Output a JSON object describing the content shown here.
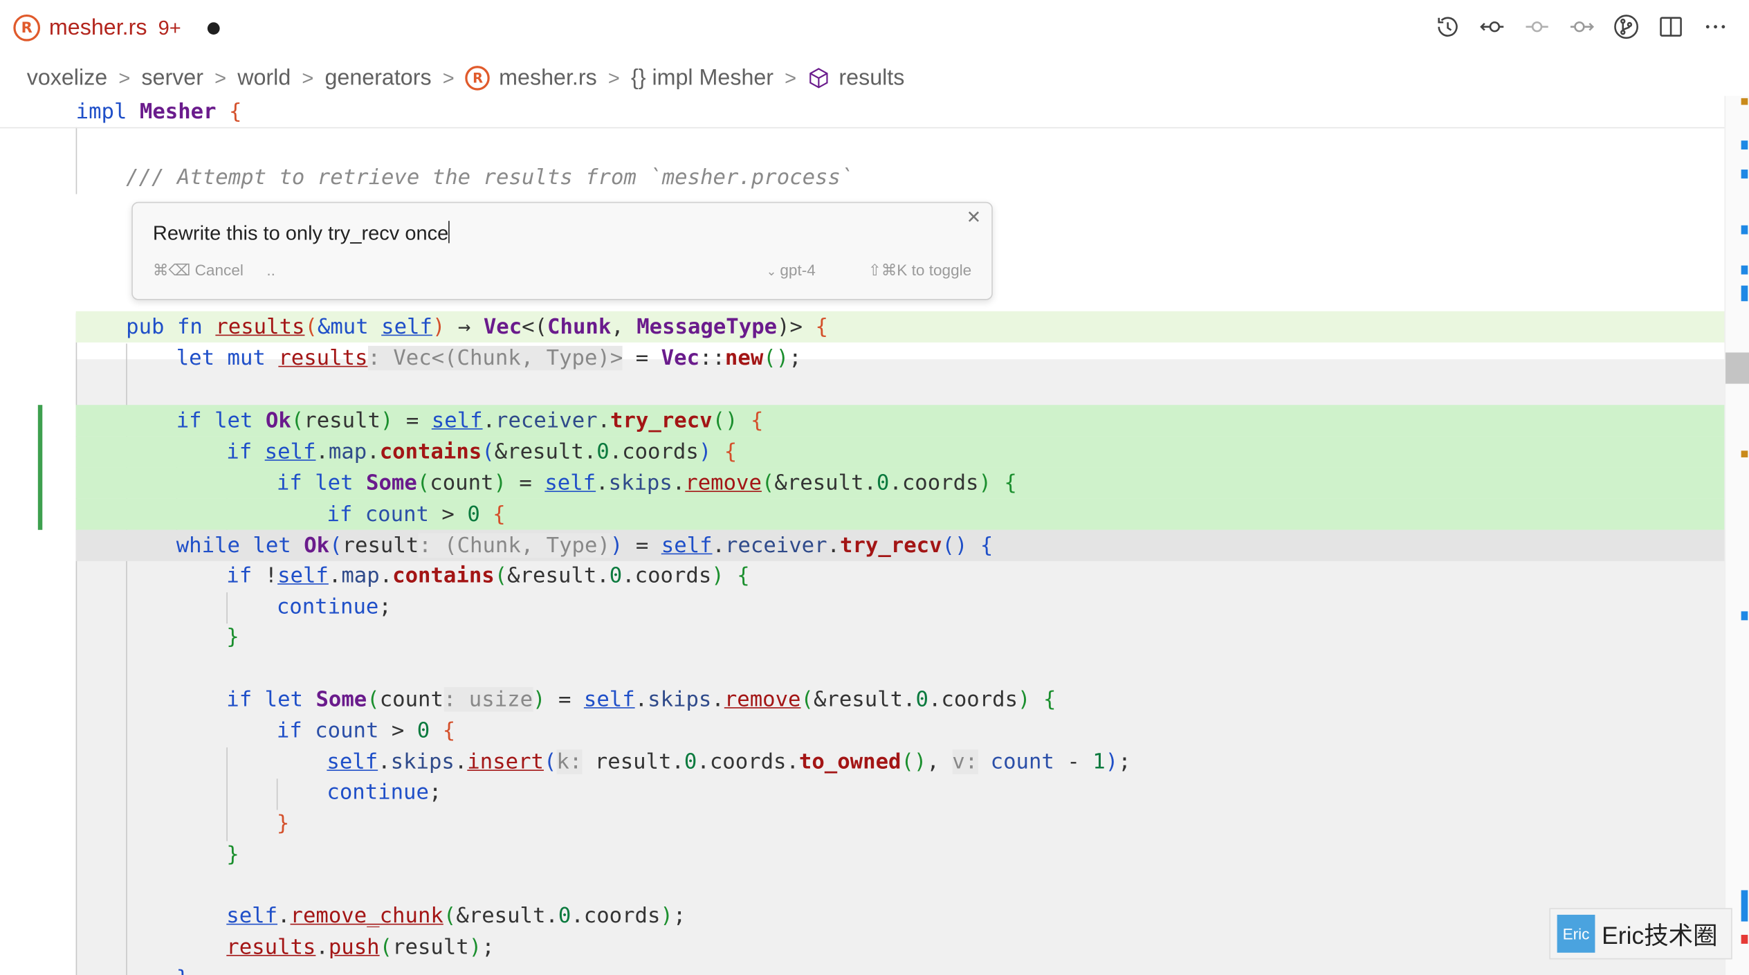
{
  "tab": {
    "filename": "mesher.rs",
    "problem_count": "9+",
    "rust_icon_glyph": "R"
  },
  "toolbar": {
    "icons": [
      "history-icon",
      "go-back-icon",
      "commit-icon",
      "go-forward-icon",
      "source-control-icon",
      "split-editor-icon",
      "more-icon"
    ]
  },
  "breadcrumb": {
    "items": [
      "voxelize",
      "server",
      "world",
      "generators",
      "mesher.rs",
      "{} impl Mesher",
      "results"
    ],
    "separator": ">"
  },
  "chat": {
    "input_value": "Rewrite this to only try_recv once",
    "cancel_label": "⌘⌫ Cancel",
    "more_label": "..",
    "model_label": "gpt-4",
    "toggle_label": "⇧⌘K to toggle",
    "close_glyph": "✕"
  },
  "watermark": {
    "logo_text": "Eric",
    "text": "Eric技术圈"
  },
  "colors": {
    "added_line": "#cff2cb",
    "function_sig_line": "#eaf7df",
    "removed_line": "#e4e4e4",
    "keyword": "#1f4fc8",
    "type": "#6a1b8c",
    "function": "#a31515",
    "gutter_added": "#3ea04f"
  }
}
